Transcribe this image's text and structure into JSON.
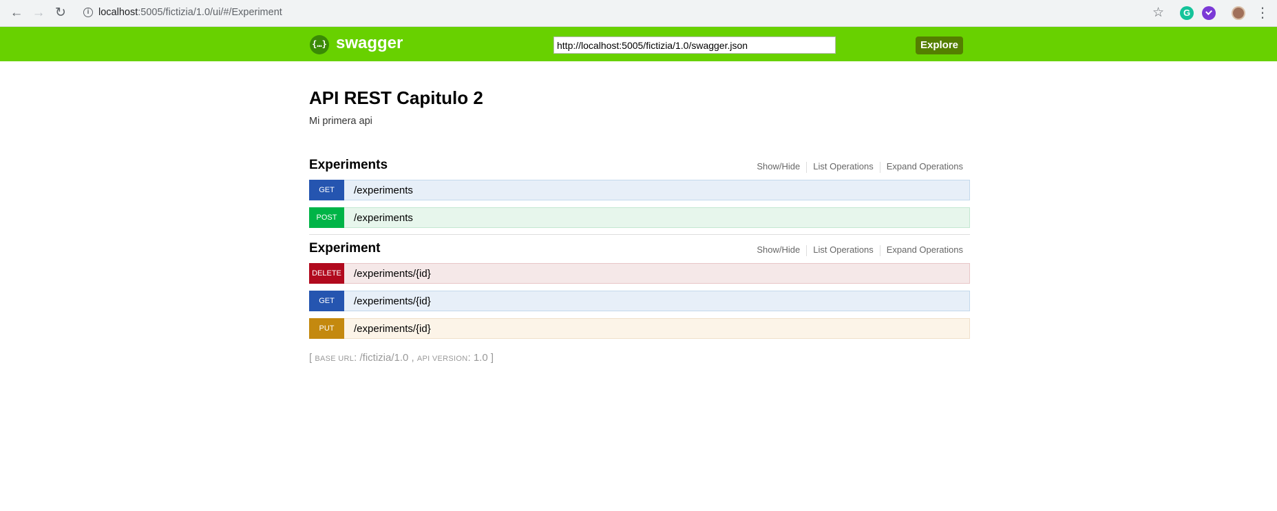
{
  "browser": {
    "url_host": "localhost",
    "url_rest": ":5005/fictizia/1.0/ui/#/Experiment",
    "back": "←",
    "forward": "→",
    "reload": "↻",
    "bookmark": "☆",
    "menu": "⋮",
    "grammarly_letter": "G",
    "info": "i"
  },
  "header": {
    "logo_glyph": "{…}",
    "logo_text": "swagger",
    "spec_url": "http://localhost:5005/fictizia/1.0/swagger.json",
    "explore_label": "Explore",
    "brand_color": "#68d100"
  },
  "api": {
    "title": "API REST Capitulo 2",
    "description": "Mi primera api"
  },
  "resources": [
    {
      "name": "Experiments",
      "options": [
        "Show/Hide",
        "List Operations",
        "Expand Operations"
      ],
      "operations": [
        {
          "method": "GET",
          "path": "/experiments"
        },
        {
          "method": "POST",
          "path": "/experiments"
        }
      ]
    },
    {
      "name": "Experiment",
      "options": [
        "Show/Hide",
        "List Operations",
        "Expand Operations"
      ],
      "operations": [
        {
          "method": "DELETE",
          "path": "/experiments/{id}"
        },
        {
          "method": "GET",
          "path": "/experiments/{id}"
        },
        {
          "method": "PUT",
          "path": "/experiments/{id}"
        }
      ]
    }
  ],
  "footer": {
    "open": "[",
    "base_url_label": "base url",
    "base_url_value": "/fictizia/1.0",
    "comma": ",",
    "api_version_label": "api version",
    "api_version_value": "1.0",
    "close": "]"
  },
  "colors": {
    "get": "#2555b0",
    "post": "#00b447",
    "delete": "#b10a1e",
    "put": "#c4890f"
  }
}
